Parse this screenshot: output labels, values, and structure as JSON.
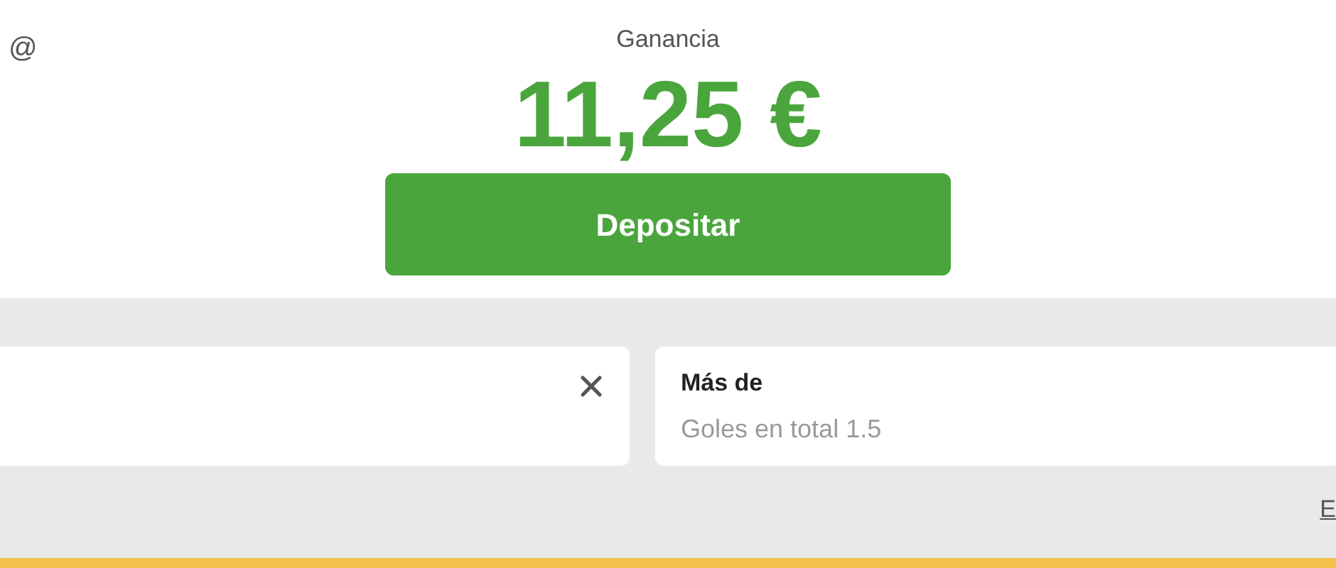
{
  "header": {
    "at_sign": "@",
    "profit_label": "Ganancia",
    "profit_amount": "11,25 €",
    "deposit_button": "Depositar"
  },
  "selections": [
    {
      "removable": true
    },
    {
      "title": "Más de",
      "subtitle": "Goles en total 1.5",
      "removable": false
    }
  ],
  "footer_link": "E"
}
